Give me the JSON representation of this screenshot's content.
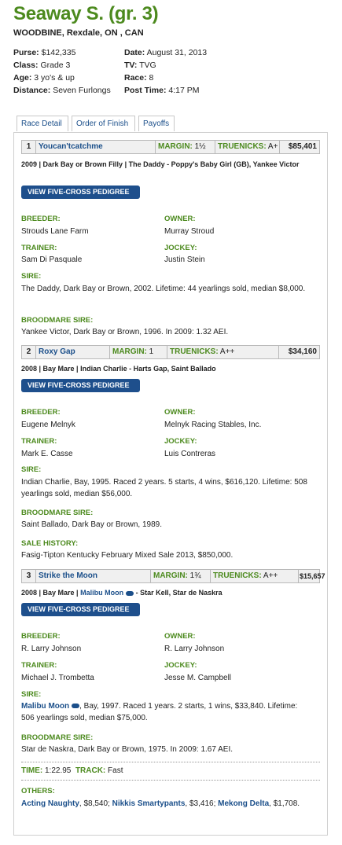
{
  "race": {
    "title": "Seaway S. (gr. 3)",
    "venue": "WOODBINE, Rexdale, ON , CAN",
    "purse_label": "Purse:",
    "purse": "$142,335",
    "class_label": "Class:",
    "class": "Grade 3",
    "age_label": "Age:",
    "age": "3 yo's & up",
    "distance_label": "Distance:",
    "distance": "Seven Furlongs",
    "date_label": "Date:",
    "date": "August 31, 2013",
    "tv_label": "TV:",
    "tv": "TVG",
    "race_label": "Race:",
    "race_no": "8",
    "post_label": "Post Time:",
    "post_time": "4:17 PM"
  },
  "tabs": [
    "Race Detail",
    "Order of Finish",
    "Payoffs"
  ],
  "labels": {
    "margin": "MARGIN:",
    "truenicks": "TRUENICKS:",
    "pedigree_button": "VIEW FIVE-CROSS PEDIGREE",
    "breeder": "BREEDER:",
    "owner": "OWNER:",
    "trainer": "TRAINER:",
    "jockey": "JOCKEY:",
    "sire": "SIRE:",
    "broodmare_sire": "BROODMARE SIRE:",
    "sale_history": "SALE HISTORY:",
    "time": "TIME:",
    "track": "TRACK:",
    "others": "OTHERS:"
  },
  "entries": [
    {
      "pos": "1",
      "horse": "Youcan'tcatchme",
      "margin": "1½",
      "truenicks": "A+",
      "earnings": "$85,401",
      "desc": "2009 | Dark Bay or Brown Filly | The Daddy - Poppy's Baby Girl (GB), Yankee Victor",
      "breeder": "Strouds Lane Farm",
      "owner": "Murray Stroud",
      "trainer": "Sam Di Pasquale",
      "jockey": "Justin Stein",
      "sire": "The Daddy, Dark Bay or Brown, 2002. Lifetime: 44 yearlings sold, median $8,000.",
      "broodmare_sire": "Yankee Victor, Dark Bay or Brown, 1996. In 2009: 1.32 AEI."
    },
    {
      "pos": "2",
      "horse": "Roxy Gap",
      "margin": "1",
      "truenicks": "A++",
      "earnings": "$34,160",
      "desc": "2008 | Bay Mare | Indian Charlie - Harts Gap, Saint Ballado",
      "breeder": "Eugene Melnyk",
      "owner": "Melnyk Racing Stables, Inc.",
      "trainer": "Mark E. Casse",
      "jockey": "Luis Contreras",
      "sire": "Indian Charlie, Bay, 1995. Raced 2 years. 5 starts, 4 wins, $616,120. Lifetime: 508 yearlings sold, median $56,000.",
      "broodmare_sire": "Saint Ballado, Dark Bay or Brown, 1989.",
      "sale_history": "Fasig-Tipton Kentucky February Mixed Sale 2013, $850,000."
    },
    {
      "pos": "3",
      "horse": "Strike the Moon",
      "margin": "1¾",
      "truenicks": "A++",
      "earnings": "$15,657",
      "desc_prefix": "2008 | Bay Mare |",
      "desc_sire": "Malibu Moon",
      "desc_suffix": "- Star Kell, Star de Naskra",
      "breeder": "R. Larry Johnson",
      "owner": "R. Larry Johnson",
      "trainer": "Michael J. Trombetta",
      "jockey": "Jesse M. Campbell",
      "sire_name": "Malibu Moon",
      "sire_rest": ", Bay, 1997. Raced 1 years. 2 starts, 1 wins, $33,840. Lifetime: 506 yearlings sold, median $75,000.",
      "broodmare_sire": "Star de Naskra, Dark Bay or Brown, 1975. In 2009: 1.67 AEI."
    }
  ],
  "footer": {
    "time": "1:22.95",
    "track": "Fast",
    "others": [
      {
        "name": "Acting Naughty",
        "amount": ", $8,540; "
      },
      {
        "name": "Nikkis Smartypants",
        "amount": ", $3,416; "
      },
      {
        "name": "Mekong Delta",
        "amount": ", $1,708."
      }
    ]
  }
}
